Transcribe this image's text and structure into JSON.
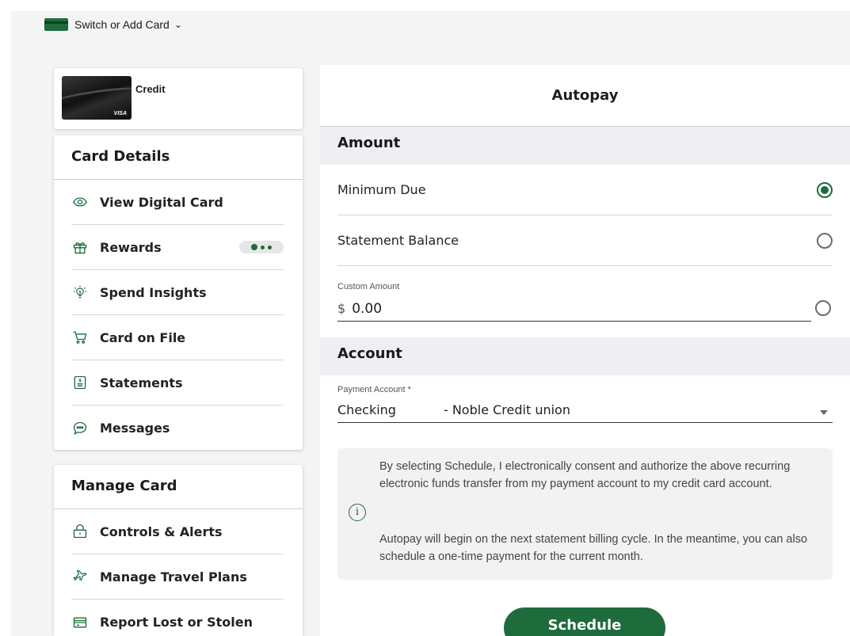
{
  "topbar": {
    "switch_label": "Switch or Add Card",
    "switch_icon": "card-icon",
    "chevron_icon": "chevron-down-icon"
  },
  "card": {
    "label": "Credit",
    "brand": "VISA"
  },
  "card_details": {
    "title": "Card Details",
    "items": [
      {
        "label": "View Digital Card",
        "icon": "eye-icon"
      },
      {
        "label": "Rewards",
        "icon": "gift-icon",
        "status": "loading-dots"
      },
      {
        "label": "Spend Insights",
        "icon": "lightbulb-dollar-icon"
      },
      {
        "label": "Card on File",
        "icon": "cart-icon"
      },
      {
        "label": "Statements",
        "icon": "document-dollar-icon"
      },
      {
        "label": "Messages",
        "icon": "chat-bubble-icon"
      }
    ]
  },
  "manage_card": {
    "title": "Manage Card",
    "items": [
      {
        "label": "Controls & Alerts",
        "icon": "lock-icon"
      },
      {
        "label": "Manage Travel Plans",
        "icon": "airplane-icon"
      },
      {
        "label": "Report Lost or Stolen",
        "icon": "card-report-icon"
      }
    ]
  },
  "autopay": {
    "title": "Autopay",
    "amount_section": "Amount",
    "options": [
      {
        "label": "Minimum Due",
        "selected": true
      },
      {
        "label": "Statement Balance",
        "selected": false
      }
    ],
    "custom": {
      "label": "Custom Amount",
      "currency": "$",
      "value": "0.00",
      "selected": false
    },
    "account_section": "Account",
    "payment_account": {
      "label": "Payment Account *",
      "value_type": "Checking",
      "value_name": "- Noble Credit union"
    },
    "notice": {
      "icon": "info-icon",
      "p1": "By selecting Schedule, I electronically consent and authorize the above recurring electronic funds transfer from my payment account to my credit card account.",
      "p2": "Autopay will begin on the next statement billing cycle. In the meantime, you can also schedule a one-time payment for the current month."
    },
    "schedule_label": "Schedule"
  },
  "colors": {
    "accent": "#1e6b3c",
    "section_bg": "#eeeef3",
    "page_bg": "#f4f4f5"
  }
}
